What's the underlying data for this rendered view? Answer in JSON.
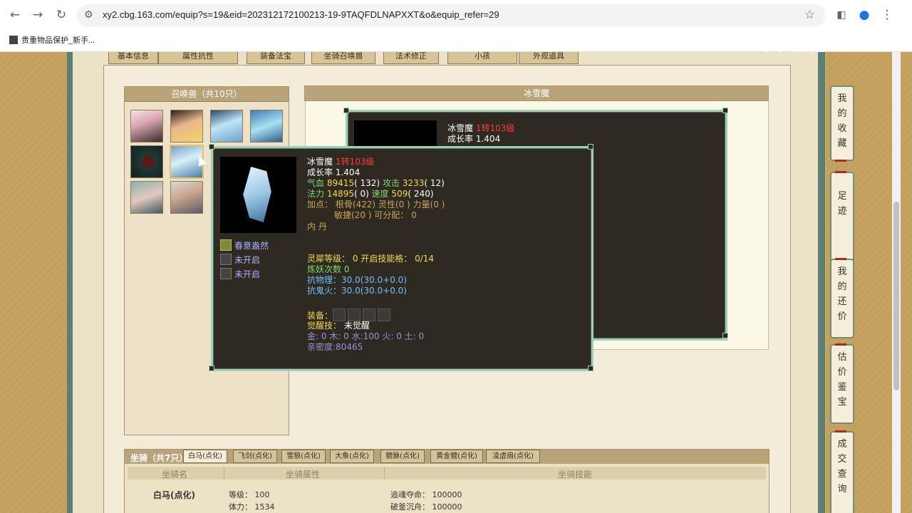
{
  "browser": {
    "url": "xy2.cbg.163.com/equip?s=19&eid=202312172100213-19-9TAQFDLNAPXXT&o&equip_refer=29",
    "bookmark": "贵重物品保护_新手..."
  },
  "watermark": "CC直播",
  "top_tabs": [
    "基本信息",
    "属性抗性",
    "装备法宝",
    "坐骑召唤兽",
    "法术修正",
    "小孩",
    "外观道具"
  ],
  "pets_panel": {
    "title": "召唤兽（共10只）"
  },
  "detail_panel": {
    "title": "冰雪魔",
    "bg_name": "冰雪魔",
    "bg_level": "1转103级",
    "bg_growth_label": "成长率",
    "bg_growth_value": "1.404"
  },
  "tooltip": {
    "name": "冰雪魔",
    "level": "1转103级",
    "growth_label": "成长率",
    "growth_value": "1.404",
    "hp_label": "气血",
    "hp_value": "89415",
    "hp_add": "( 132)",
    "atk_label": "攻击",
    "atk_value": "3233",
    "atk_add": "( 12)",
    "mp_label": "法力",
    "mp_value": "14895",
    "mp_add": "( 0)",
    "spd_label": "速度",
    "spd_value": "509",
    "spd_add": "( 240)",
    "points_line1": "加点：  根骨(422) 灵性(0 ) 力量(0 )",
    "points_line2": "敏捷(20 ) 可分配：  0",
    "neidan": "内    丹",
    "skills": [
      {
        "name": "春意盎然"
      },
      {
        "name": "未开启"
      },
      {
        "name": "未开启"
      }
    ],
    "lingxi": "灵犀等级：  0  开启技能格：  0/14",
    "lianyao": "炼妖次数 0",
    "kang_wuli_label": "抗物理：",
    "kang_wuli_value": "30.0(30.0+0.0)",
    "kang_guihuo_label": "抗鬼火：",
    "kang_guihuo_value": "30.0(30.0+0.0)",
    "equip_label": "装备：",
    "juexing_label": "觉醒技：",
    "juexing_value": "未觉醒",
    "elements": "金: 0  木: 0  水:100  火: 0  土: 0",
    "intimacy": "亲密度:80465"
  },
  "mounts": {
    "title": "坐骑（共7只）",
    "tabs": [
      "白马(点化)",
      "飞剑(点化)",
      "雪狼(点化)",
      "大象(点化)",
      "貔貅(点化)",
      "黄金貔(点化)",
      "凌虚扇(点化)"
    ],
    "col_name": "坐骑名",
    "col_attr": "坐骑属性",
    "col_skill": "坐骑技能",
    "row_name": "白马(点化)",
    "attr1": "等级：  100",
    "attr2": "体力：  1534",
    "skill1": "追魂夺命：  100000",
    "skill2": "破釜沉舟：  100000"
  },
  "sidebar": [
    "我的收藏",
    "足迹",
    "我的还价",
    "估价鉴宝",
    "成交查询"
  ]
}
